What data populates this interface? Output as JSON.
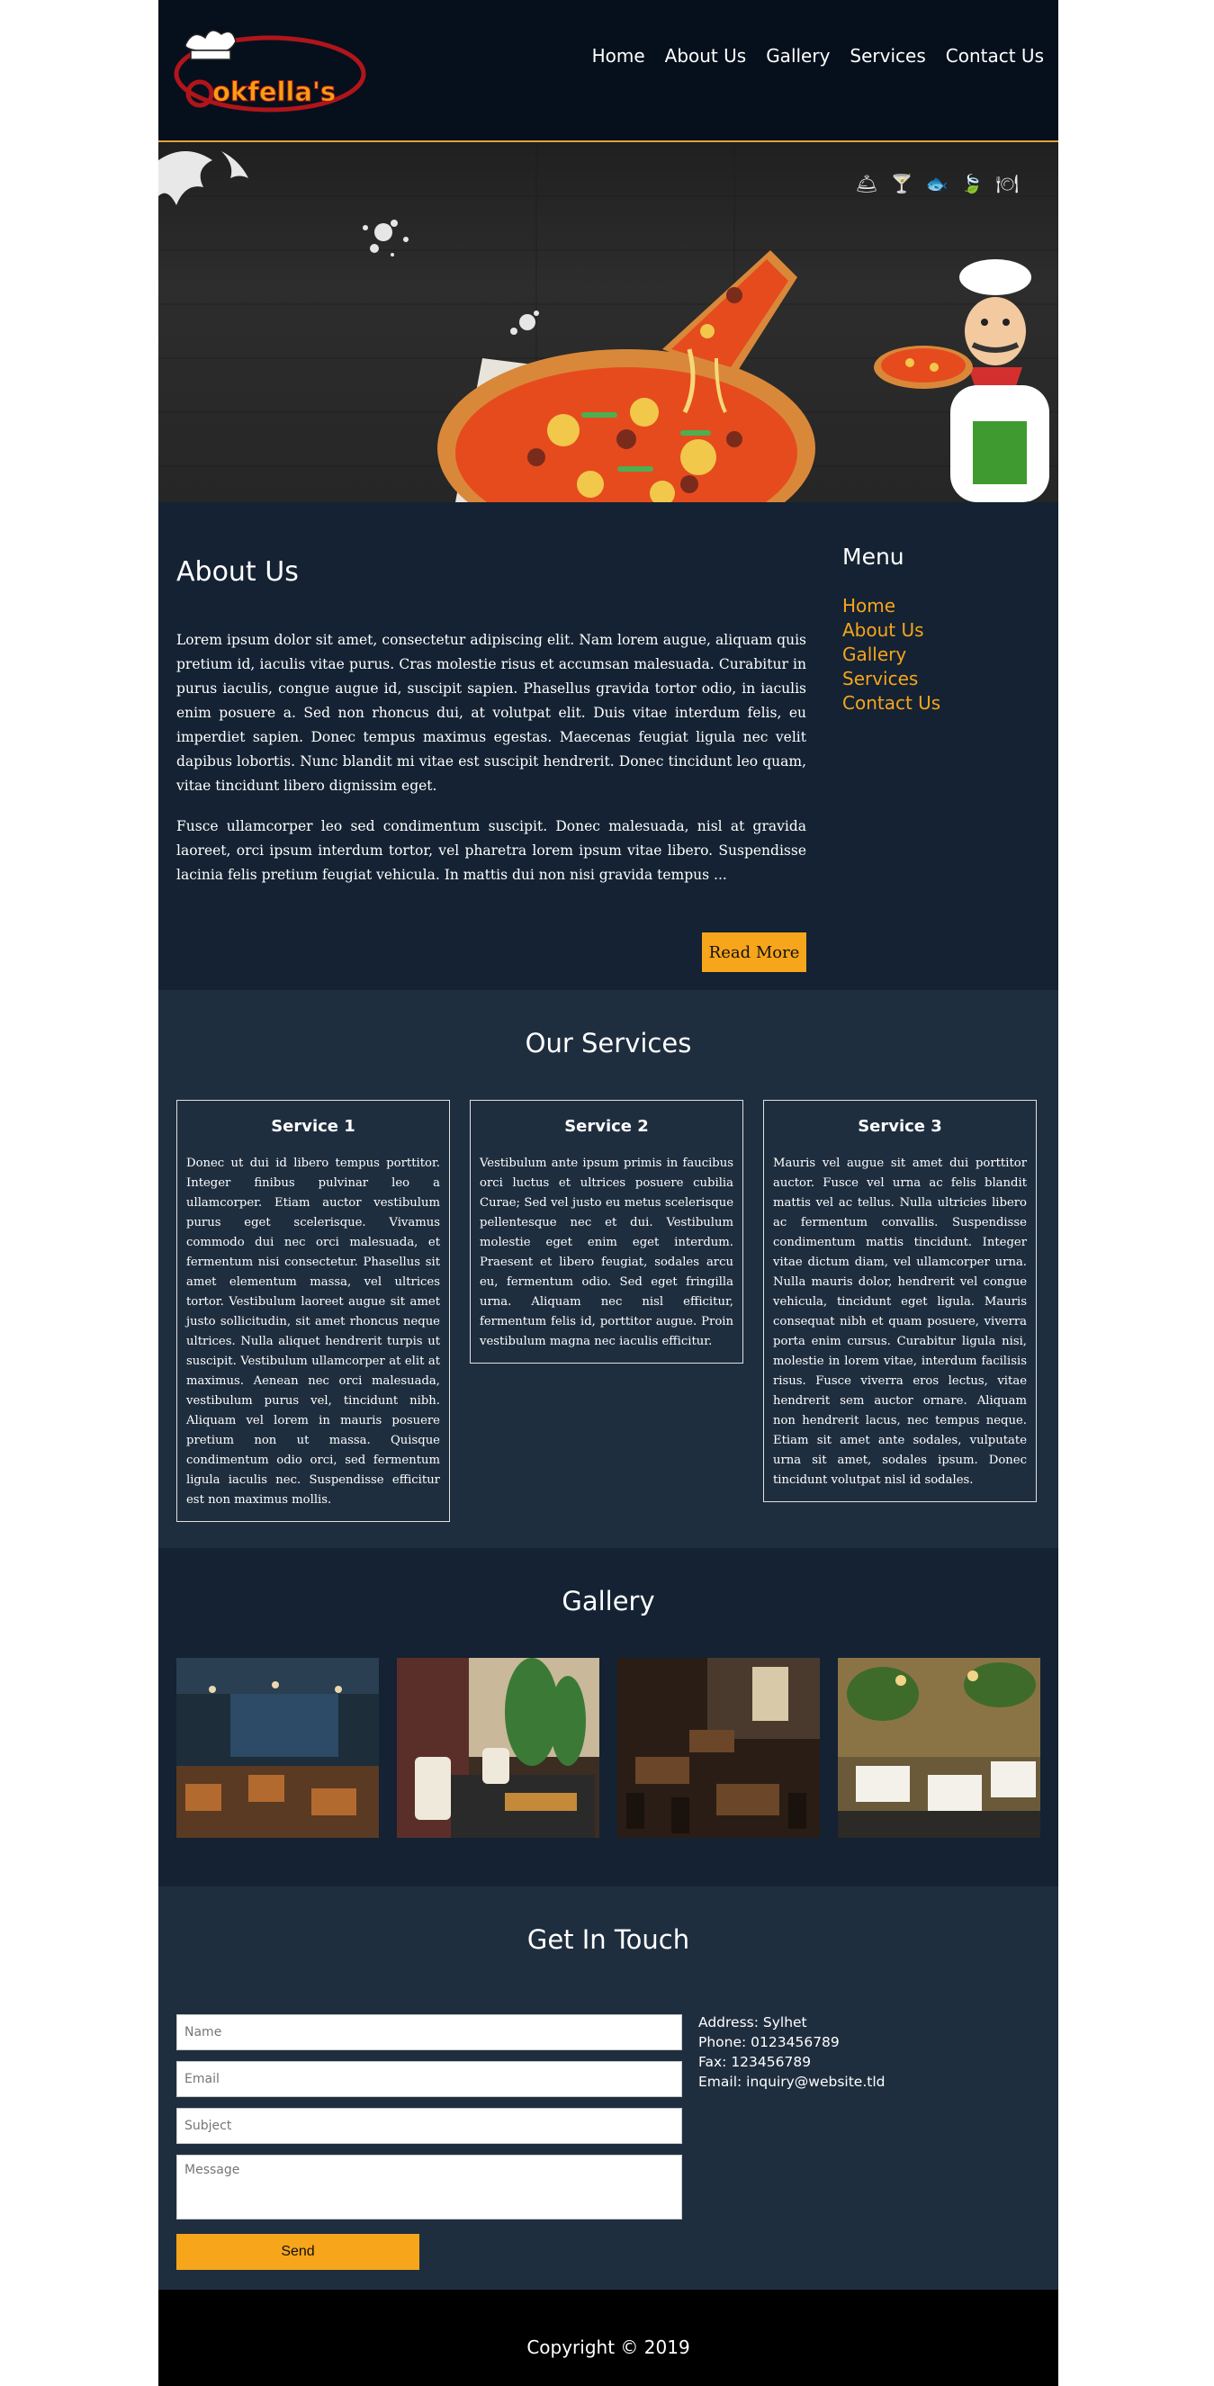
{
  "header": {
    "logo_text": "Cookfella's",
    "nav": [
      "Home",
      "About Us",
      "Gallery",
      "Services",
      "Contact Us"
    ]
  },
  "hero": {
    "icons": [
      "cloche-icon",
      "cocktail-icon",
      "fish-icon",
      "leaf-icon",
      "plate-icon"
    ]
  },
  "about": {
    "title": "About Us",
    "para1": "Lorem ipsum dolor sit amet, consectetur adipiscing elit. Nam lorem augue, aliquam quis pretium id, iaculis vitae purus. Cras molestie risus et accumsan malesuada. Curabitur in purus iaculis, congue augue id, suscipit sapien. Phasellus gravida tortor odio, in iaculis enim posuere a. Sed non rhoncus dui, at volutpat elit. Duis vitae interdum felis, eu imperdiet sapien. Donec tempus maximus egestas. Maecenas feugiat ligula nec velit dapibus lobortis. Nunc blandit mi vitae est suscipit hendrerit. Donec tincidunt leo quam, vitae tincidunt libero dignissim eget.",
    "para2": "Fusce ullamcorper leo sed condimentum suscipit. Donec malesuada, nisl at gravida laoreet, orci ipsum interdum tortor, vel pharetra lorem ipsum vitae libero. Suspendisse lacinia felis pretium feugiat vehicula. In mattis dui non nisi gravida tempus ...",
    "read_more": "Read More"
  },
  "menu": {
    "title": "Menu",
    "items": [
      "Home",
      "About Us",
      "Gallery",
      "Services",
      "Contact Us"
    ]
  },
  "services": {
    "title": "Our Services",
    "items": [
      {
        "title": "Service 1",
        "text": "Donec ut dui id libero tempus porttitor. Integer finibus pulvinar leo a ullamcorper. Etiam auctor vestibulum purus eget scelerisque. Vivamus commodo dui nec orci malesuada, et fermentum nisi consectetur. Phasellus sit amet elementum massa, vel ultrices tortor. Vestibulum laoreet augue sit amet justo sollicitudin, sit amet rhoncus neque ultrices. Nulla aliquet hendrerit turpis ut suscipit. Vestibulum ullamcorper at elit at maximus. Aenean nec orci malesuada, vestibulum purus vel, tincidunt nibh. Aliquam vel lorem in mauris posuere pretium non ut massa. Quisque condimentum odio orci, sed fermentum ligula iaculis nec. Suspendisse efficitur est non maximus mollis."
      },
      {
        "title": "Service 2",
        "text": "Vestibulum ante ipsum primis in faucibus orci luctus et ultrices posuere cubilia Curae; Sed vel justo eu metus scelerisque pellentesque nec et dui. Vestibulum molestie eget enim eget interdum. Praesent et libero feugiat, sodales arcu eu, fermentum odio. Sed eget fringilla urna. Aliquam nec nisl efficitur, fermentum felis id, porttitor augue. Proin vestibulum magna nec iaculis efficitur."
      },
      {
        "title": "Service 3",
        "text": "Mauris vel augue sit amet dui porttitor auctor. Fusce vel urna ac felis blandit mattis vel ac tellus. Nulla ultricies libero ac fermentum convallis. Suspendisse condimentum mattis tincidunt. Integer vitae dictum diam, vel ullamcorper urna. Nulla mauris dolor, hendrerit vel congue vehicula, tincidunt eget ligula. Mauris consequat nibh et quam posuere, viverra porta enim cursus. Curabitur ligula nisi, molestie in lorem vitae, interdum facilisis risus. Fusce viverra eros lectus, vitae hendrerit sem auctor ornare. Aliquam non hendrerit lacus, nec tempus neque. Etiam sit amet ante sodales, vulputate urna sit amet, sodales ipsum. Donec tincidunt volutpat nisl id sodales."
      }
    ]
  },
  "gallery": {
    "title": "Gallery"
  },
  "contact": {
    "title": "Get In Touch",
    "name_placeholder": "Name",
    "email_placeholder": "Email",
    "subject_placeholder": "Subject",
    "message_placeholder": "Message",
    "send": "Send",
    "address": "Address: Sylhet",
    "phone": "Phone: 0123456789",
    "fax": "Fax: 123456789",
    "email": "Email: inquiry@website.tld"
  },
  "footer": {
    "copyright": "Copyright © 2019"
  },
  "colors": {
    "accent": "#f7a51b",
    "header_bg": "#06101c",
    "section_dark": "#142233",
    "section_light": "#1f2e3f",
    "footer_bg": "#000000"
  }
}
